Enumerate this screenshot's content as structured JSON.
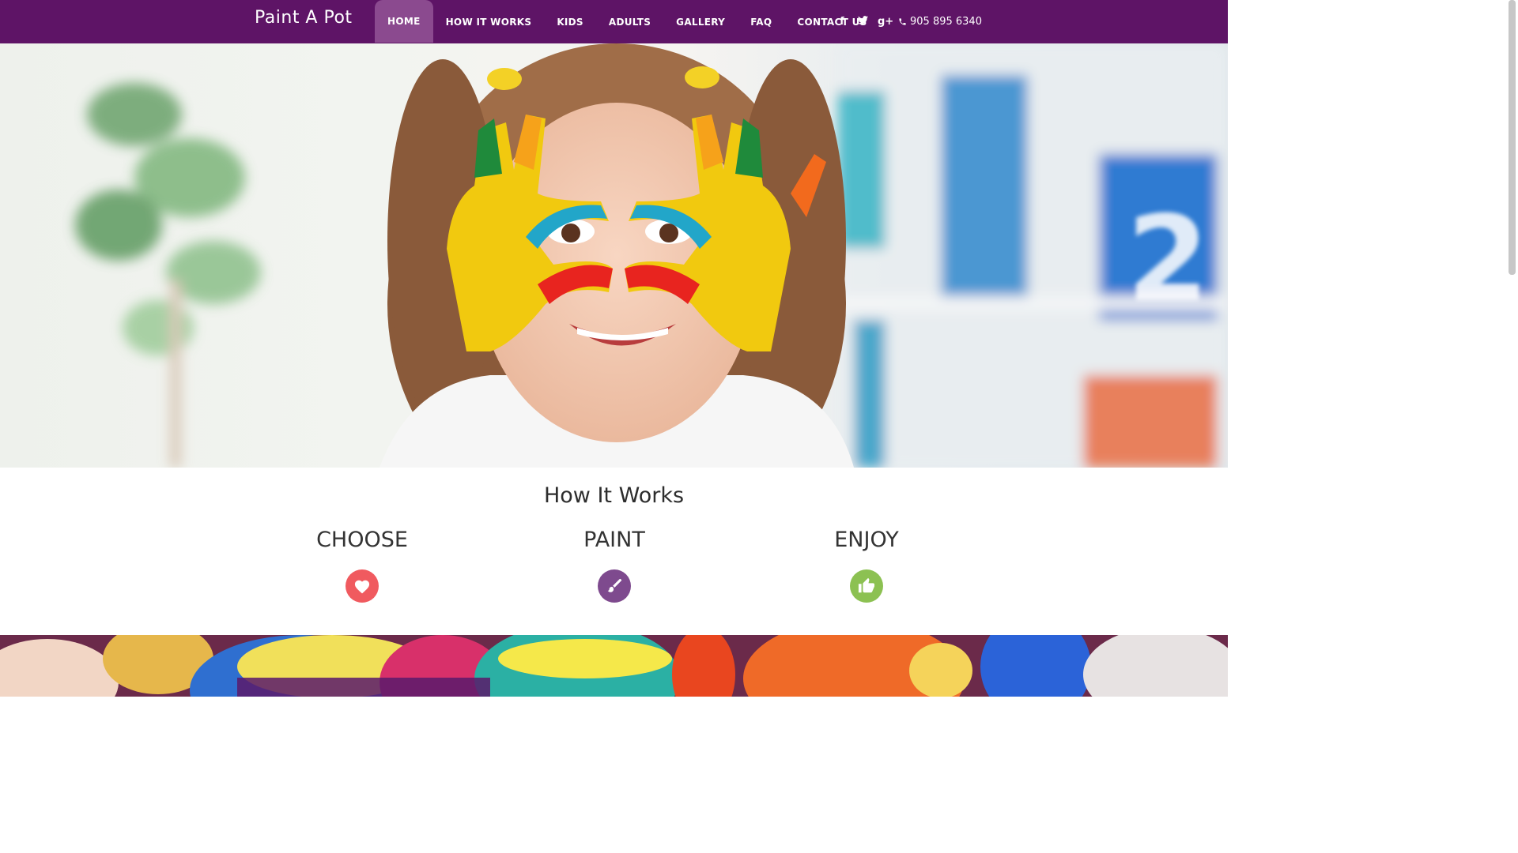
{
  "brand": {
    "name": "Paint A Pot"
  },
  "nav": {
    "items": [
      {
        "label": "HOME",
        "active": true
      },
      {
        "label": "HOW IT WORKS",
        "active": false
      },
      {
        "label": "KIDS",
        "active": false
      },
      {
        "label": "ADULTS",
        "active": false
      },
      {
        "label": "GALLERY",
        "active": false
      },
      {
        "label": "FAQ",
        "active": false
      },
      {
        "label": "CONTACT US",
        "active": false
      }
    ]
  },
  "social": {
    "icons": [
      "facebook-icon",
      "twitter-icon",
      "google-plus-icon"
    ],
    "phone": "905 895 6340"
  },
  "hero": {
    "image": "girl-with-painted-hands-photo"
  },
  "how_it_works": {
    "title": "How It Works",
    "steps": [
      {
        "label": "CHOOSE",
        "icon": "heart-icon",
        "color": "#f05a5f"
      },
      {
        "label": "PAINT",
        "icon": "paintbrush-icon",
        "color": "#7e4a8e"
      },
      {
        "label": "ENJOY",
        "icon": "thumbs-up-icon",
        "color": "#8cc152"
      }
    ]
  },
  "colors": {
    "navbar": "#5e1466",
    "nav_active": "#8b4a8f"
  }
}
